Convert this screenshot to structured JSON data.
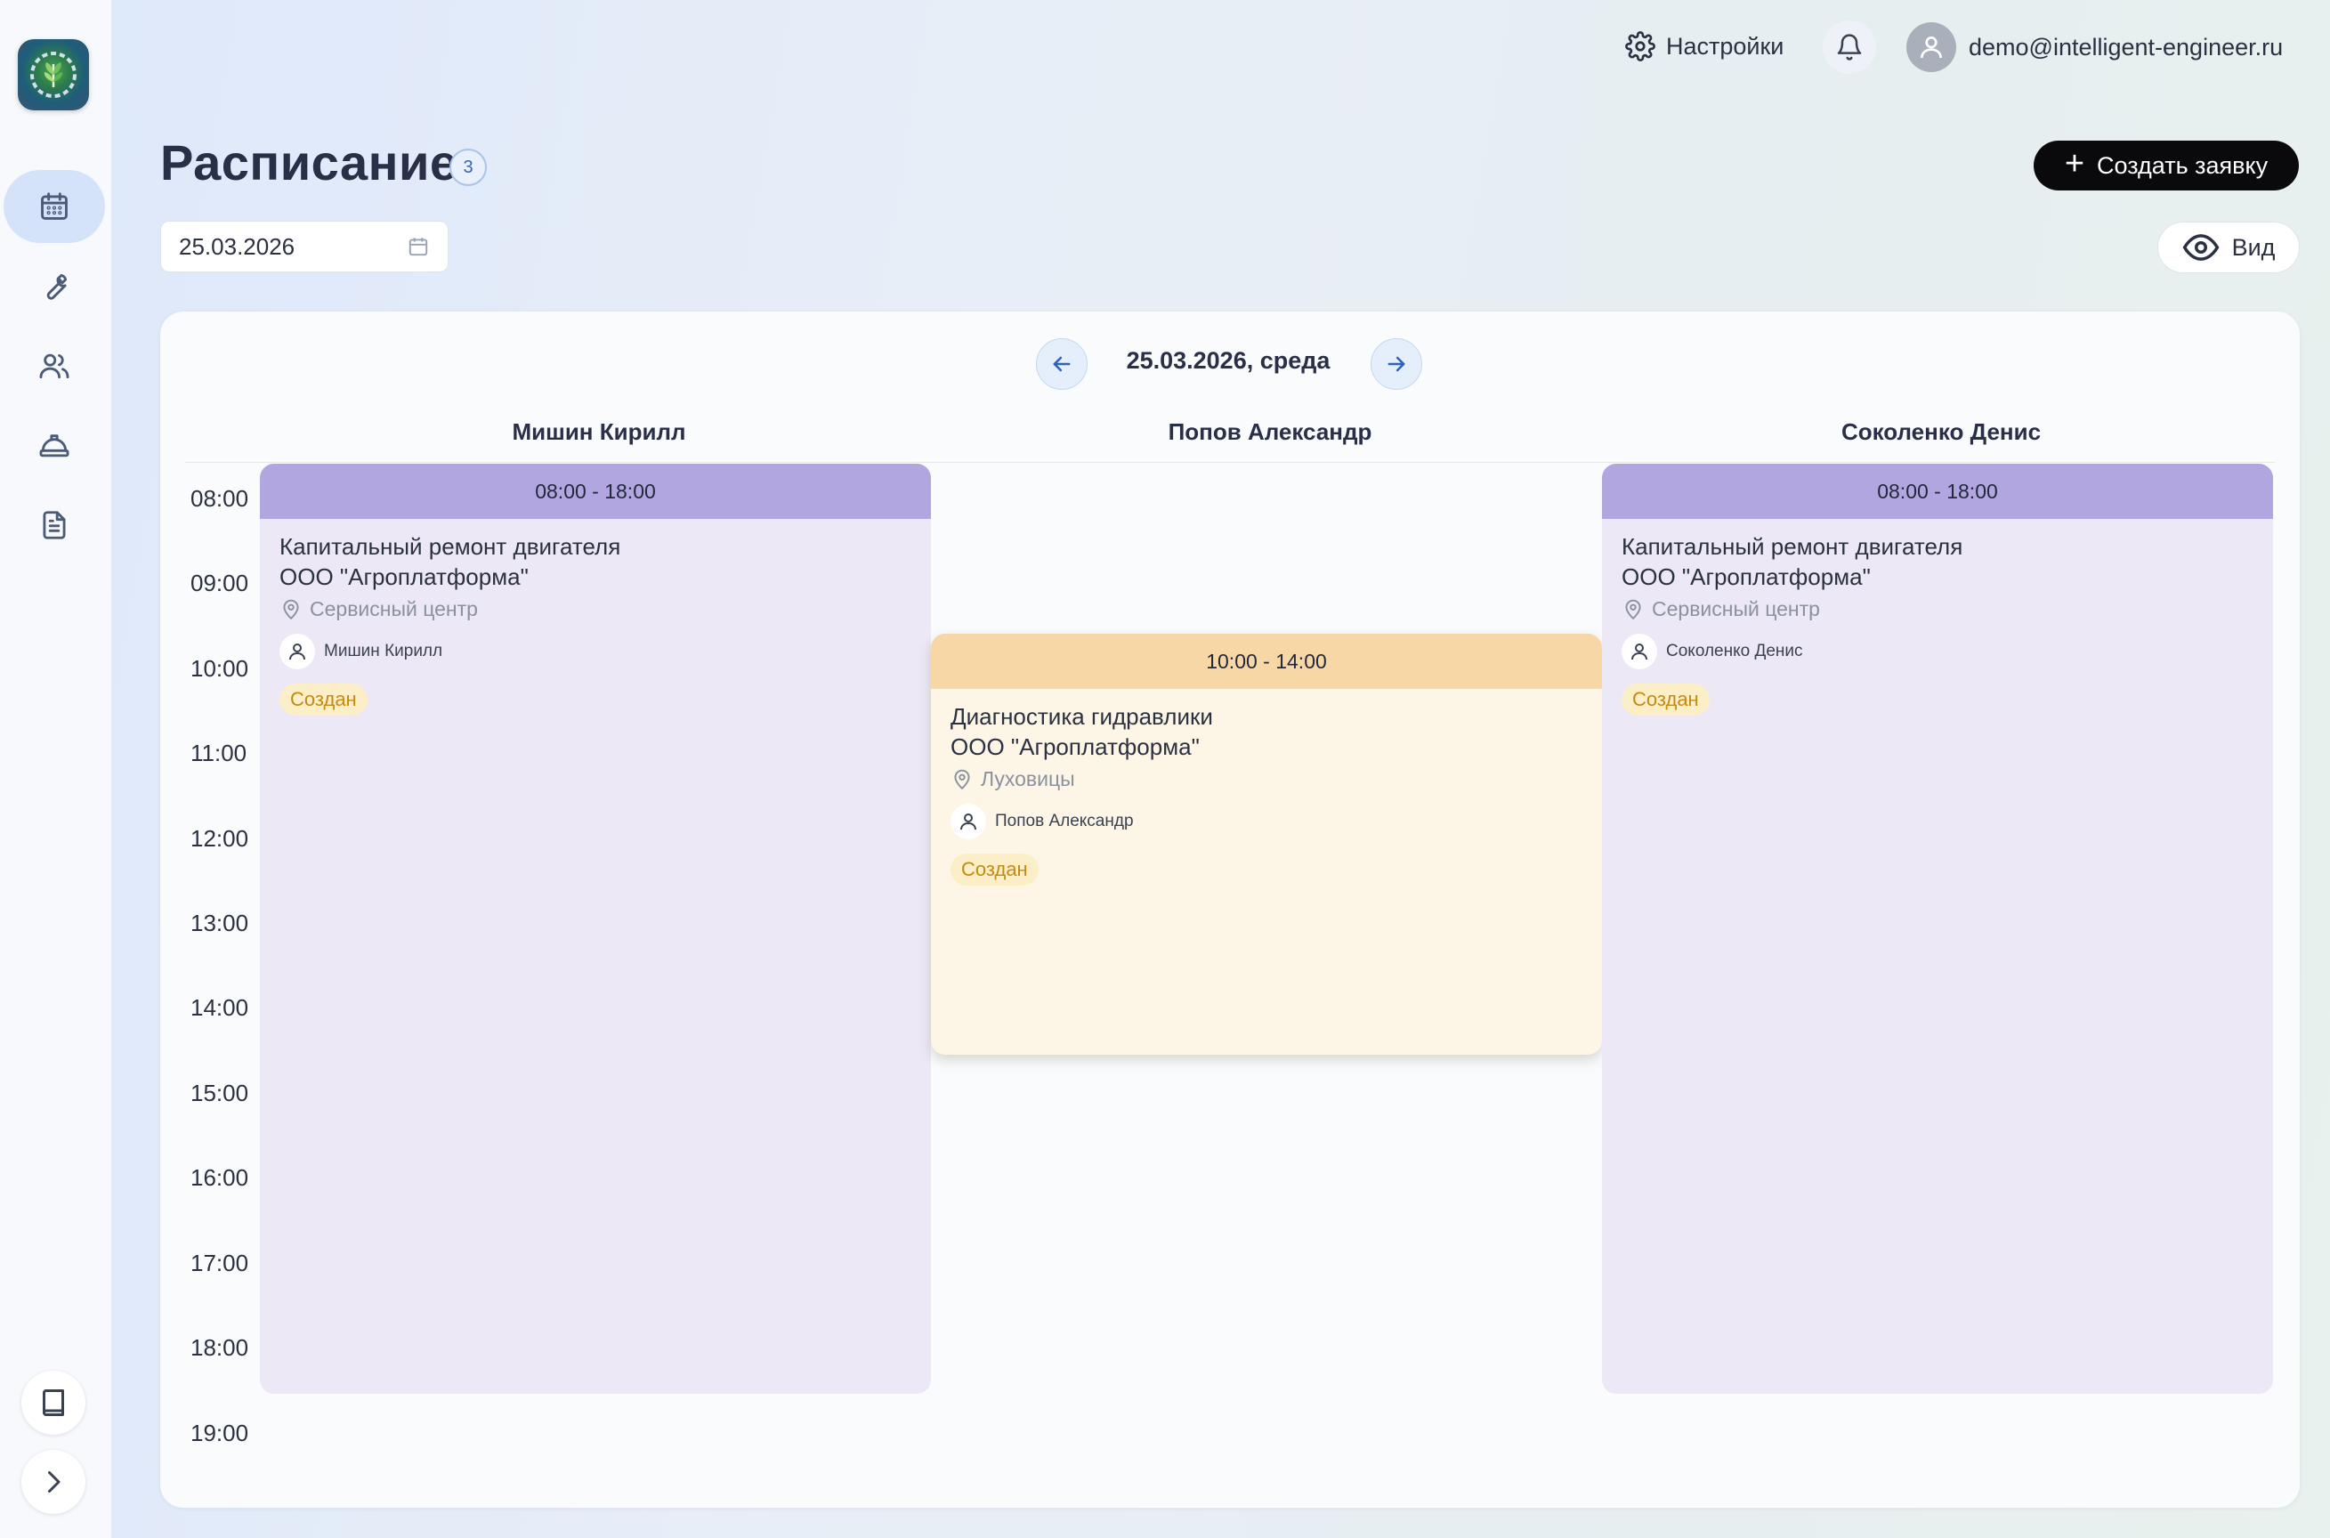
{
  "topbar": {
    "settings_label": "Настройки",
    "user_email": "demo@intelligent-engineer.ru"
  },
  "header": {
    "title": "Расписание",
    "count": "3",
    "create_label": "Создать заявку",
    "date_value": "25.03.2026",
    "view_label": "Вид"
  },
  "schedule": {
    "day_label": "25.03.2026, среда",
    "columns": [
      "Мишин Кирилл",
      "Попов Александр",
      "Соколенко Денис"
    ],
    "hours": [
      "08:00",
      "09:00",
      "10:00",
      "11:00",
      "12:00",
      "13:00",
      "14:00",
      "15:00",
      "16:00",
      "17:00",
      "18:00",
      "19:00"
    ],
    "events": [
      {
        "time": "08:00 - 18:00",
        "title": "Капитальный ремонт двигателя",
        "client": "ООО \"Агроплатформа\"",
        "place": "Сервисный центр",
        "person": "Мишин Кирилл",
        "status": "Создан",
        "color": "#b2a6e1"
      },
      {
        "time": "10:00 - 14:00",
        "title": "Диагностика гидравлики",
        "client": "ООО \"Агроплатформа\"",
        "place": "Луховицы",
        "person": "Попов Александр",
        "status": "Создан",
        "color": "#f7d7a6"
      },
      {
        "time": "08:00 - 18:00",
        "title": "Капитальный ремонт двигателя",
        "client": "ООО \"Агроплатформа\"",
        "place": "Сервисный центр",
        "person": "Соколенко Денис",
        "status": "Создан",
        "color": "#b2a6e1"
      }
    ]
  },
  "sidebar": {
    "items": [
      {
        "icon": "calendar-icon",
        "active": true
      },
      {
        "icon": "wrench-icon",
        "active": false
      },
      {
        "icon": "users-icon",
        "active": false
      },
      {
        "icon": "hard-hat-icon",
        "active": false
      },
      {
        "icon": "document-icon",
        "active": false
      }
    ],
    "bottom": [
      {
        "icon": "book-icon"
      },
      {
        "icon": "chevron-right-icon"
      }
    ]
  }
}
